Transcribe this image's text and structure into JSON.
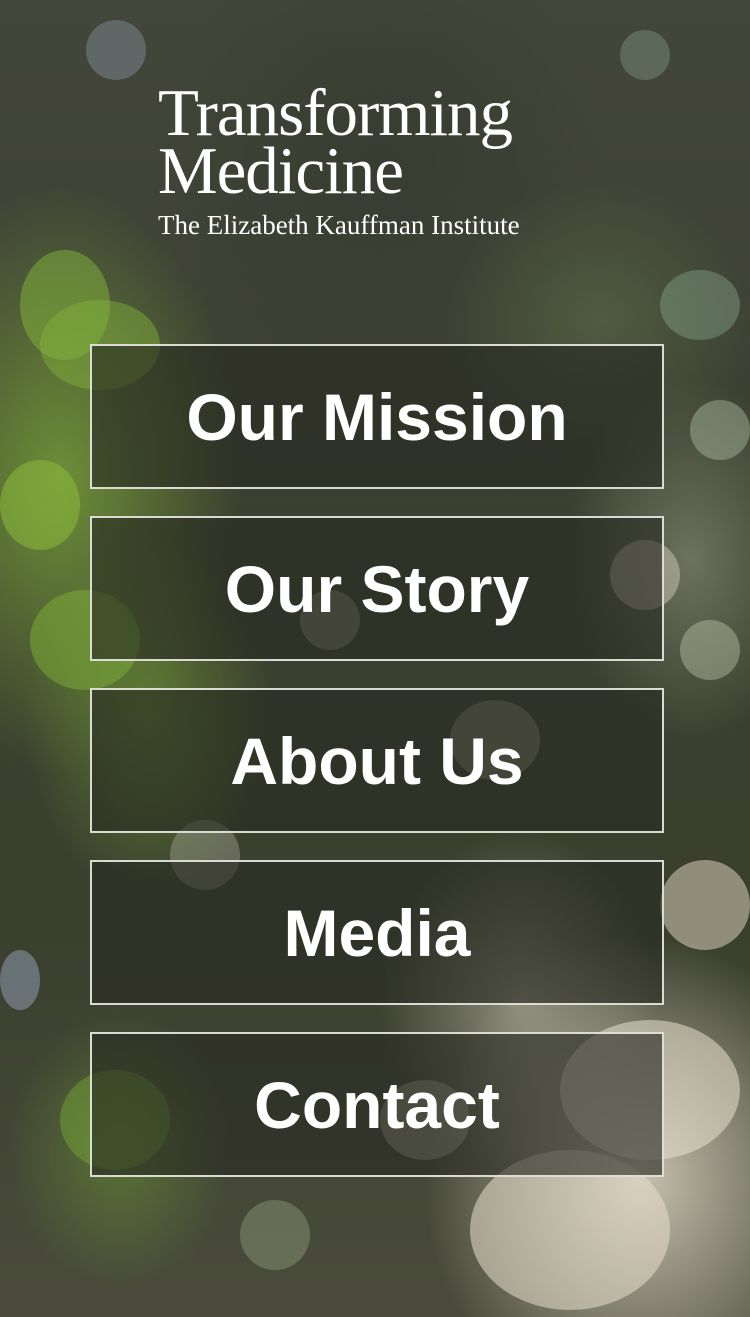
{
  "logo": {
    "line1": "Transforming",
    "line2": "Medicine",
    "subtitle": "The Elizabeth Kauffman Institute"
  },
  "nav": {
    "items": [
      {
        "label": "Our Mission"
      },
      {
        "label": "Our Story"
      },
      {
        "label": "About Us"
      },
      {
        "label": "Media"
      },
      {
        "label": "Contact"
      }
    ]
  },
  "colors": {
    "text": "#ffffff",
    "button_border": "#e8e8e2",
    "background_dark": "#3a3d32",
    "foliage_green": "#7eaa3a"
  }
}
